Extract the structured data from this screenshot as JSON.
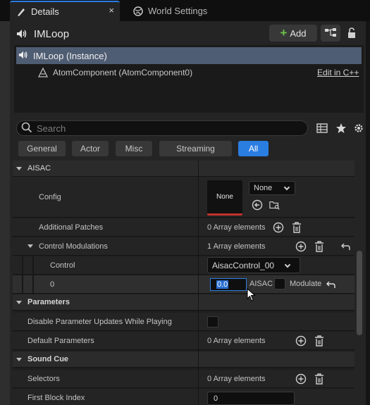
{
  "tabs": [
    {
      "label": "Details",
      "icon": "details-icon",
      "active": true
    },
    {
      "label": "World Settings",
      "icon": "globe-icon",
      "active": false
    }
  ],
  "tab_close": "×",
  "header": {
    "actor_name": "IMLoop",
    "add_label": "Add"
  },
  "components": {
    "selected": "IMLoop (Instance)",
    "child": "AtomComponent (AtomComponent0)",
    "edit_link": "Edit in C++"
  },
  "search": {
    "placeholder": "Search",
    "value": ""
  },
  "filters": [
    "General",
    "Actor",
    "Misc",
    "Streaming",
    "All"
  ],
  "active_filter": "All",
  "sections": {
    "aisac": {
      "title": "AISAC",
      "config_label": "Config",
      "config_thumb": "None",
      "config_combo": "None",
      "additional_patches_label": "Additional Patches",
      "additional_patches_value": "0 Array elements",
      "control_modulations_label": "Control Modulations",
      "control_modulations_value": "1 Array elements",
      "control_label": "Control",
      "control_value": "AisacControl_00",
      "index_label": "0",
      "index_value": "0.0",
      "aisac_label": "AISAC",
      "modulate_label": "Modulate"
    },
    "parameters": {
      "title": "Parameters",
      "disable_label": "Disable Parameter Updates While Playing",
      "default_label": "Default Parameters",
      "default_value": "0 Array elements"
    },
    "sound_cue": {
      "title": "Sound Cue",
      "selectors_label": "Selectors",
      "selectors_value": "0 Array elements",
      "first_block_label": "First Block Index",
      "first_block_value": "0"
    }
  },
  "colors": {
    "accent": "#2a7de1",
    "selection": "#4f5d73",
    "add_plus": "#6cc24a",
    "thumb_underline": "#c0312b"
  }
}
